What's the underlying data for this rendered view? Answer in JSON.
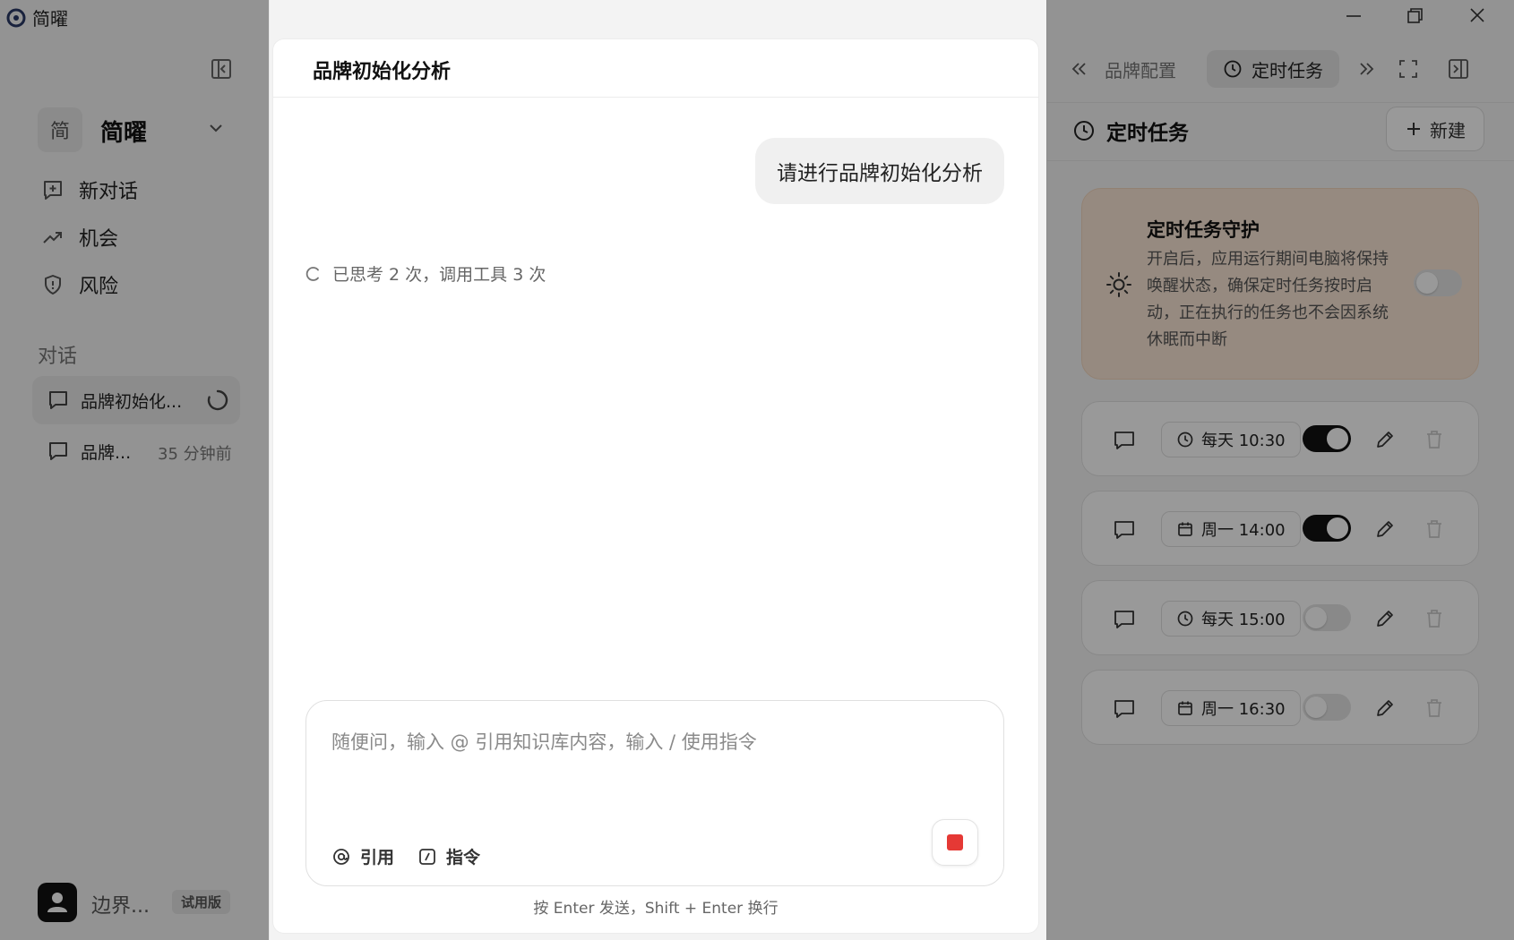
{
  "app": {
    "title": "简曜",
    "logo_icon": "app-logo-icon"
  },
  "sidebar": {
    "workspace": {
      "avatar_text": "简",
      "name": "简曜"
    },
    "nav": [
      {
        "label": "新对话",
        "icon": "new-chat-icon"
      },
      {
        "label": "机会",
        "icon": "trend-up-icon"
      },
      {
        "label": "风险",
        "icon": "shield-icon"
      }
    ],
    "section_label": "对话",
    "conversations": [
      {
        "label": "品牌初始化...",
        "status": "loading"
      },
      {
        "label": "品牌...",
        "time": "35 分钟前"
      }
    ],
    "user": {
      "name": "边界...",
      "badge": "试用版"
    }
  },
  "chat": {
    "title": "品牌初始化分析",
    "user_message": "请进行品牌初始化分析",
    "thinking": "已思考 2 次，调用工具 3 次",
    "composer": {
      "placeholder": "随便问，输入 @ 引用知识库内容，输入 / 使用指令",
      "quote_label": "引用",
      "command_label": "指令"
    },
    "hint": "按 Enter 发送，Shift + Enter 换行"
  },
  "right_panel": {
    "tabs": [
      {
        "label": "品牌配置",
        "active": false
      },
      {
        "label": "定时任务",
        "active": true
      }
    ],
    "header_title": "定时任务",
    "new_label": "新建",
    "guard": {
      "title": "定时任务守护",
      "description": "开启后，应用运行期间电脑将保持唤醒状态，确保定时任务按时启动，正在执行的任务也不会因系统休眠而中断",
      "enabled": false
    },
    "tasks": [
      {
        "schedule": "每天 10:30",
        "icon": "clock-icon",
        "enabled": true
      },
      {
        "schedule": "周一 14:00",
        "icon": "calendar-icon",
        "enabled": true
      },
      {
        "schedule": "每天 15:00",
        "icon": "clock-icon",
        "enabled": false
      },
      {
        "schedule": "周一 16:30",
        "icon": "calendar-icon",
        "enabled": false
      }
    ]
  },
  "colors": {
    "stop": "#e53935",
    "toggle_on": "#111111",
    "guard_bg": "#fbe7d5"
  }
}
